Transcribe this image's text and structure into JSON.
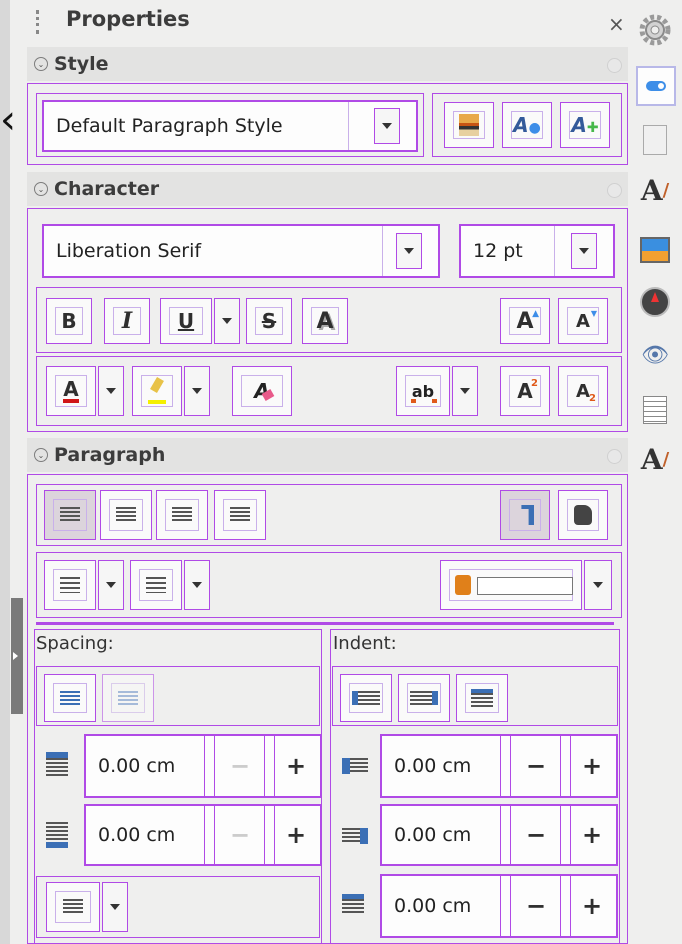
{
  "panel": {
    "title": "Properties",
    "close_glyph": "×"
  },
  "style": {
    "header": "Style",
    "selected": "Default Paragraph Style"
  },
  "character": {
    "header": "Character",
    "font_name": "Liberation Serif",
    "font_size": "12 pt",
    "bold": "B",
    "italic": "I",
    "underline": "U",
    "strike": "S",
    "shadow": "A",
    "grow": "A",
    "shrink": "A",
    "font_color": "A",
    "clear": "A",
    "spacing": "ab",
    "super": "A",
    "sub": "A",
    "super_mark": "2",
    "sub_mark": "2"
  },
  "paragraph": {
    "header": "Paragraph",
    "spacing_label": "Spacing:",
    "indent_label": "Indent:",
    "above_value": "0.00 cm",
    "below_value": "0.00 cm",
    "before_value": "0.00 cm",
    "after_value": "0.00 cm",
    "first_line_value": "0.00 cm",
    "minus": "−",
    "plus": "+"
  },
  "colors": {
    "accent": "#b04ae6",
    "font_red": "#d01616",
    "highlight_yellow": "#f4f000",
    "toggle_blue": "#3d8ee8"
  },
  "icons": [
    "gear-icon",
    "properties-icon",
    "page-icon",
    "styles-icon",
    "gallery-icon",
    "navigator-icon",
    "manage-changes-icon",
    "design-icon",
    "style-inspector-icon"
  ]
}
